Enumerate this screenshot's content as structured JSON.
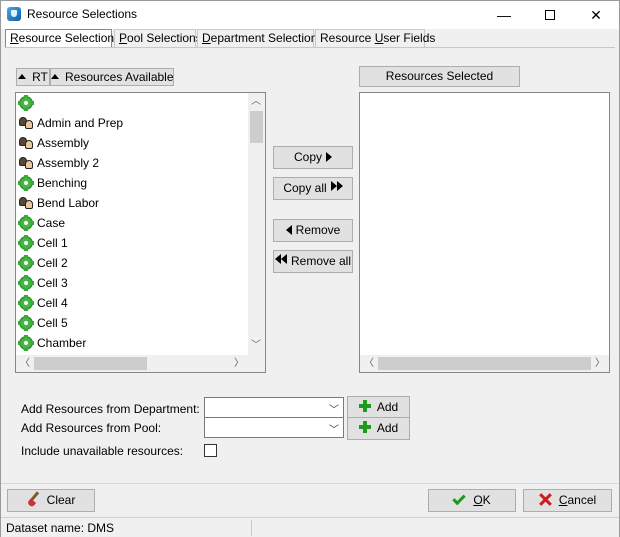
{
  "window": {
    "title": "Resource Selections",
    "minimize": "—",
    "close": "✕"
  },
  "tabs": [
    {
      "pre": "",
      "mn": "R",
      "post": "esource Selections"
    },
    {
      "pre": "",
      "mn": "P",
      "post": "ool Selections"
    },
    {
      "pre": "",
      "mn": "D",
      "post": "epartment Selections"
    },
    {
      "pre": "Resource ",
      "mn": "U",
      "post": "ser Fields"
    }
  ],
  "available": {
    "col_rt": "RT",
    "col_name": "Resources Available",
    "items": [
      {
        "icon": "gear-icon",
        "label": ""
      },
      {
        "icon": "people-icon",
        "label": "Admin and Prep"
      },
      {
        "icon": "people-icon",
        "label": "Assembly"
      },
      {
        "icon": "people-icon",
        "label": "Assembly 2"
      },
      {
        "icon": "gear-icon",
        "label": "Benching"
      },
      {
        "icon": "people-icon",
        "label": "Bend Labor"
      },
      {
        "icon": "gear-icon",
        "label": "Case"
      },
      {
        "icon": "gear-icon",
        "label": "Cell 1"
      },
      {
        "icon": "gear-icon",
        "label": "Cell 2"
      },
      {
        "icon": "gear-icon",
        "label": "Cell 3"
      },
      {
        "icon": "gear-icon",
        "label": "Cell 4"
      },
      {
        "icon": "gear-icon",
        "label": "Cell 5"
      },
      {
        "icon": "gear-icon",
        "label": "Chamber"
      }
    ]
  },
  "selected": {
    "header": "Resources Selected"
  },
  "transfer": {
    "copy": "Copy",
    "copy_all": "Copy all",
    "remove": "Remove",
    "remove_all": "Remove all"
  },
  "add_from_department": {
    "label": "Add Resources from Department:",
    "value": "",
    "button": "Add"
  },
  "add_from_pool": {
    "label": "Add Resources from Pool:",
    "value": "",
    "button": "Add"
  },
  "include_unavailable": {
    "label": "Include unavailable resources:"
  },
  "footer": {
    "clear": "Clear",
    "ok_mn": "O",
    "ok_rest": "K",
    "cancel_mn": "C",
    "cancel_rest": "ancel"
  },
  "status": {
    "dataset_label": "Dataset name:",
    "dataset_value": "DMS"
  }
}
